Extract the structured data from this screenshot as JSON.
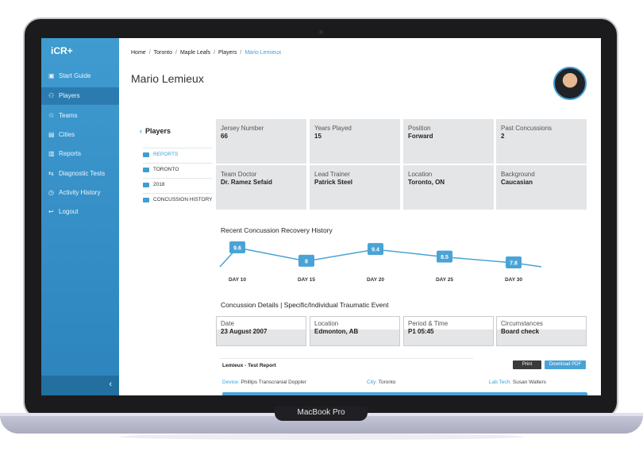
{
  "device": {
    "model_label": "MacBook Pro"
  },
  "app": {
    "logo": "iCR+"
  },
  "sidebar": {
    "items": [
      {
        "label": "Start Guide",
        "icon": "book-icon"
      },
      {
        "label": "Players",
        "icon": "users-icon"
      },
      {
        "label": "Teams",
        "icon": "recycle-icon"
      },
      {
        "label": "Cities",
        "icon": "building-icon"
      },
      {
        "label": "Reports",
        "icon": "document-icon"
      },
      {
        "label": "Diagnostic Tests",
        "icon": "swap-arrows-icon"
      },
      {
        "label": "Activity History",
        "icon": "history-icon"
      },
      {
        "label": "Logout",
        "icon": "logout-icon"
      }
    ],
    "active_item": "Players",
    "collapse_icon": "chevron-left-icon"
  },
  "breadcrumb": [
    "Home",
    "Toronto",
    "Maple Leafs",
    "Players",
    "Mario Lemieux"
  ],
  "page": {
    "title": "Mario Lemieux"
  },
  "panel": {
    "back_label": "Players",
    "folders": [
      {
        "label": "REPORTS",
        "active": true
      },
      {
        "label": "TORONTO",
        "active": false
      },
      {
        "label": "2018",
        "active": false
      },
      {
        "label": "CONCUSSION HISTORY",
        "active": false
      }
    ]
  },
  "info_grid": [
    {
      "label": "Jersey Number",
      "value": "66"
    },
    {
      "label": "Years Played",
      "value": "15"
    },
    {
      "label": "Position",
      "value": "Forward"
    },
    {
      "label": "Past Concussions",
      "value": "2"
    },
    {
      "label": "Team Doctor",
      "value": "Dr. Ramez Sefaid"
    },
    {
      "label": "Lead Trainer",
      "value": "Patrick Steel"
    },
    {
      "label": "Location",
      "value": "Toronto, ON"
    },
    {
      "label": "Background",
      "value": "Caucasian"
    }
  ],
  "chart_data": {
    "type": "line",
    "title": "Recent Concussion Recovery History",
    "categories": [
      "DAY 10",
      "DAY 15",
      "DAY 20",
      "DAY 25",
      "DAY 30"
    ],
    "values": [
      9.6,
      8.0,
      9.4,
      8.5,
      7.8
    ],
    "color": "#4aa3d6"
  },
  "concussion_details": {
    "heading": "Concussion Details  |  Specific/Individual Traumatic Event",
    "fields": [
      {
        "label": "Date",
        "value": "23 August 2007"
      },
      {
        "label": "Location",
        "value": "Edmonton, AB"
      },
      {
        "label": "Period & Time",
        "value": "P1 05:45"
      },
      {
        "label": "Circumstances",
        "value": "Board check"
      }
    ]
  },
  "report": {
    "title": "Lemieux - Test Report",
    "print_label": "Print",
    "download_label": "Download PDF",
    "device_key": "Device:",
    "device_value": "Phillips Transcranial Doppler",
    "city_key": "City:",
    "city_value": "Toronto",
    "labtech_key": "Lab Tech:",
    "labtech_value": "Susan Walters"
  },
  "colors": {
    "accent": "#3e9fd4",
    "sidebar": "#3896cc",
    "print_button": "#3a3b3d"
  }
}
